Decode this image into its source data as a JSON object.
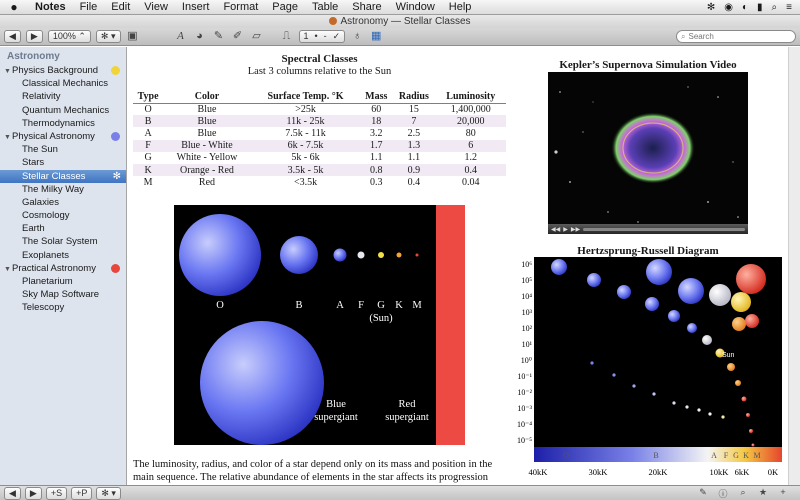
{
  "menubar": {
    "apple": "",
    "items": [
      "Notes",
      "File",
      "Edit",
      "View",
      "Insert",
      "Format",
      "Page",
      "Table",
      "Share",
      "Window",
      "Help"
    ],
    "status_icons": [
      "✻",
      "◉",
      "◐",
      "▮",
      "⌕",
      "≡"
    ]
  },
  "window": {
    "title": "Astronomy — Stellar Classes"
  },
  "toolbar": {
    "back": "◀",
    "forward": "▶",
    "zoom": "100%",
    "action": "✻",
    "page_steppers": [
      "1",
      "•",
      "-",
      "✓"
    ],
    "search_placeholder": "Search"
  },
  "sidebar": {
    "header": "Astronomy",
    "items": [
      {
        "label": "Physics Background",
        "type": "group",
        "dot": "#f0d43a"
      },
      {
        "label": "Classical Mechanics",
        "type": "child"
      },
      {
        "label": "Relativity",
        "type": "child"
      },
      {
        "label": "Quantum Mechanics",
        "type": "child"
      },
      {
        "label": "Thermodynamics",
        "type": "child"
      },
      {
        "label": "Physical Astronomy",
        "type": "group",
        "dot": "#7b7fe8"
      },
      {
        "label": "The Sun",
        "type": "child"
      },
      {
        "label": "Stars",
        "type": "child"
      },
      {
        "label": "Stellar Classes",
        "type": "child",
        "selected": true
      },
      {
        "label": "The Milky Way",
        "type": "child"
      },
      {
        "label": "Galaxies",
        "type": "child"
      },
      {
        "label": "Cosmology",
        "type": "child"
      },
      {
        "label": "Earth",
        "type": "child"
      },
      {
        "label": "The Solar System",
        "type": "child"
      },
      {
        "label": "Exoplanets",
        "type": "child"
      },
      {
        "label": "Practical Astronomy",
        "type": "group",
        "dot": "#e8453b"
      },
      {
        "label": "Planetarium",
        "type": "child"
      },
      {
        "label": "Sky Map Software",
        "type": "child"
      },
      {
        "label": "Telescopy",
        "type": "child"
      }
    ]
  },
  "content": {
    "table_title": "Spectral Classes",
    "table_subtitle": "Last 3 columns relative to the Sun",
    "table_headers": [
      "Type",
      "Color",
      "Surface Temp. °K",
      "Mass",
      "Radius",
      "Luminosity"
    ],
    "table_rows": [
      [
        "O",
        "Blue",
        ">25k",
        "60",
        "15",
        "1,400,000"
      ],
      [
        "B",
        "Blue",
        "11k - 25k",
        "18",
        "7",
        "20,000"
      ],
      [
        "A",
        "Blue",
        "7.5k - 11k",
        "3.2",
        "2.5",
        "80"
      ],
      [
        "F",
        "Blue - White",
        "6k - 7.5k",
        "1.7",
        "1.3",
        "6"
      ],
      [
        "G",
        "White - Yellow",
        "5k - 6k",
        "1.1",
        "1.1",
        "1.2"
      ],
      [
        "K",
        "Orange - Red",
        "3.5k - 5k",
        "0.8",
        "0.9",
        "0.4"
      ],
      [
        "M",
        "Red",
        "<3.5k",
        "0.3",
        "0.4",
        "0.04"
      ]
    ],
    "diagram": {
      "class_labels": [
        "O",
        "B",
        "A",
        "F",
        "G",
        "K",
        "M"
      ],
      "sun_label": "(Sun)",
      "supergiant_blue": [
        "Blue",
        "supergiant"
      ],
      "supergiant_red": [
        "Red",
        "supergiant"
      ]
    },
    "paragraph": "The luminosity, radius, and color of a star depend only on its mass and position in the main sequence. The relative abundance of elements in the star affects its progression through the",
    "video_title": "Kepler’s Supernova Simulation Video",
    "video_controls": [
      "◀◀",
      "▶",
      "▶▶"
    ],
    "hr_title": "Hertzsprung-Russell Diagram",
    "hr": {
      "y_labels": [
        "10⁶",
        "10⁵",
        "10⁴",
        "10³",
        "10²",
        "10¹",
        "10⁰",
        "10⁻¹",
        "10⁻²",
        "10⁻³",
        "10⁻⁴",
        "10⁻⁵"
      ],
      "x_labels": [
        "40kK",
        "30kK",
        "20kK",
        "10kK",
        "6kK",
        "0K"
      ],
      "class_labels": [
        "O",
        "B",
        "A",
        "F",
        "G",
        "K",
        "M"
      ],
      "sun_label": "Sun"
    }
  },
  "bottombar": {
    "add_section": "+S",
    "add_page": "+P",
    "action": "✻",
    "right_icons": [
      "✎",
      "ⓘ",
      "⌕",
      "★",
      "+"
    ]
  },
  "colors": {
    "sidebar_bg": "#dde4ee",
    "selection": "#3f74c2",
    "diagram_bg": "#000000",
    "red_supergiant": "#f04c45"
  }
}
